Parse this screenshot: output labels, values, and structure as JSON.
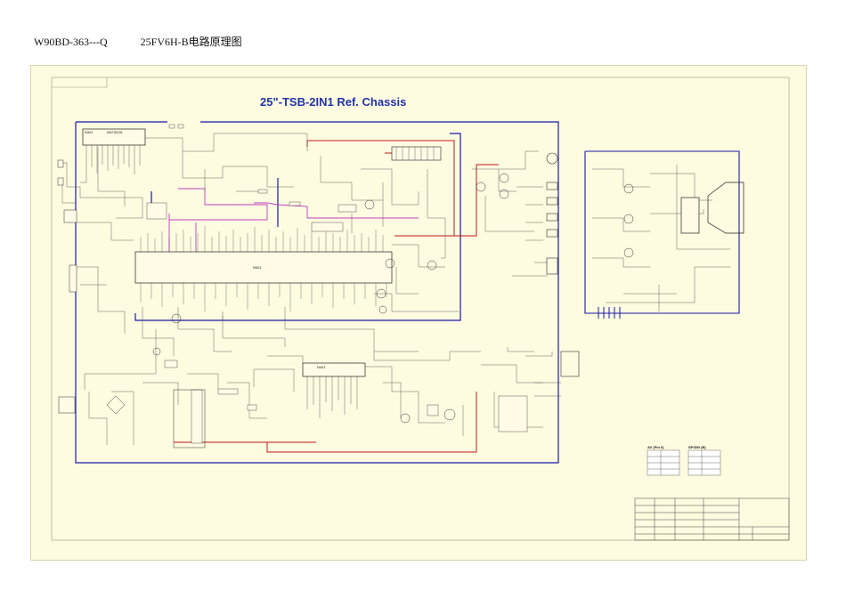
{
  "header": {
    "model_code": "W90BD-363---Q",
    "model_title": "25FV6H-B电路原理图"
  },
  "chassis_title": "25\"-TSB-2IN1 Ref. Chassis",
  "blocks": {
    "tuner_ic": {
      "ref": "N301",
      "part": "AN7522N"
    },
    "main_ic_label": "N501",
    "deflection_ic_label": "N401"
  },
  "tables": {
    "left_title": "AV (Pin 6)",
    "right_title": "SP/SW (B)"
  },
  "colors": {
    "sheet_bg": "#fdfbe0",
    "bus_blue": "#1a1aa8",
    "power_red": "#c01818",
    "signal_magenta": "#c040c0",
    "wire_gray": "#555555",
    "title_blue": "#2233aa"
  }
}
